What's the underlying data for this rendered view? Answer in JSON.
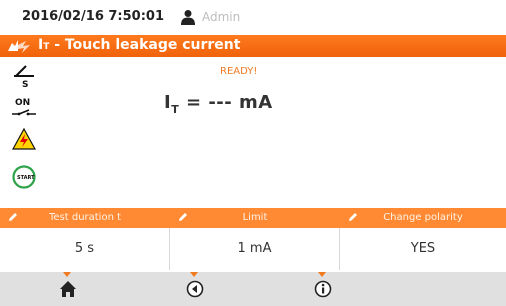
{
  "status": {
    "datetime": "2016/02/16 7:50:01",
    "user": "Admin"
  },
  "title": {
    "symbol": "I",
    "symbol_sub": "T",
    "text": " - Touch leakage current"
  },
  "measurement": {
    "state": "READY!",
    "symbol": "I",
    "symbol_sub": "T",
    "value": " = --- mA"
  },
  "side_icons": [
    "electrode-icon",
    "on-switch-icon",
    "high-voltage-warning-icon",
    "start-icon"
  ],
  "side_labels": {
    "electrode": "S",
    "switch": "ON",
    "start": "START"
  },
  "params": [
    {
      "label": "Test duration t",
      "value": "5 s"
    },
    {
      "label": "Limit",
      "value": "1 mA"
    },
    {
      "label": "Change polarity",
      "value": "YES"
    }
  ],
  "bottom": [
    "home-icon",
    "back-icon",
    "info-icon"
  ],
  "colors": {
    "accent": "#f0620a",
    "header_tab": "#ff8a33",
    "footer": "#e0e0e0"
  }
}
